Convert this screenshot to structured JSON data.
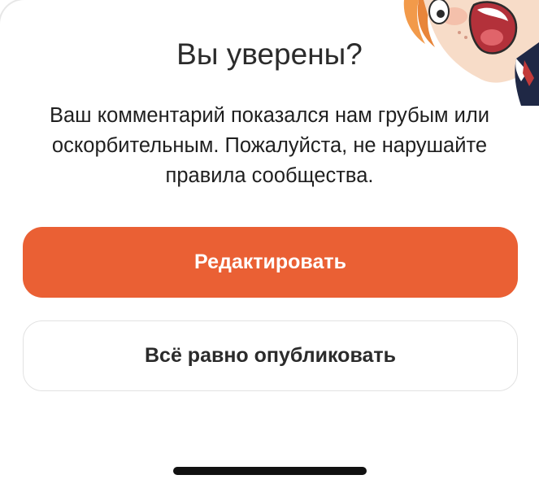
{
  "dialog": {
    "title": "Вы уверены?",
    "message": "Ваш комментарий показался нам грубым или оскорбительным. Пожалуйста, не нарушайте правила сообщества.",
    "primary_button_label": "Редактировать",
    "secondary_button_label": "Всё равно опубликовать",
    "mascot_icon": "surprised-character-illustration"
  },
  "colors": {
    "accent": "#ea6034",
    "title_text": "#2b2b2b",
    "secondary_border": "#e2e2e2"
  }
}
